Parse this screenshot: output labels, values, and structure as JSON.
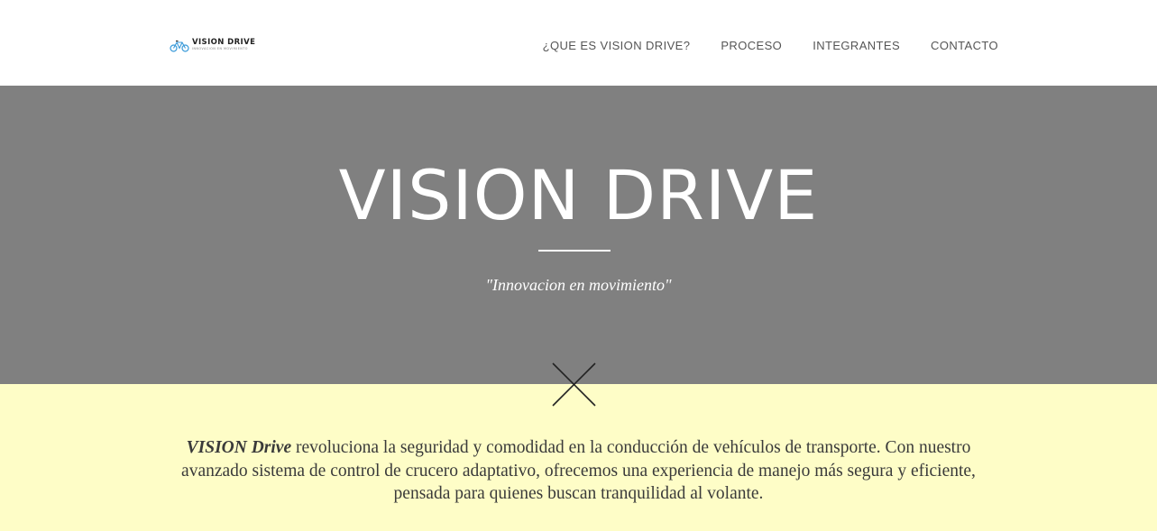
{
  "header": {
    "logo": {
      "name": "VISION DRIVE",
      "tagline": "INNOVACION EN MOVIMIENTO",
      "icon": "bicycle-car-icon"
    },
    "nav": [
      {
        "label": "¿QUE ES VISION DRIVE?"
      },
      {
        "label": "PROCESO"
      },
      {
        "label": "INTEGRANTES"
      },
      {
        "label": "CONTACTO"
      }
    ]
  },
  "hero": {
    "title": "VISION DRIVE",
    "subtitle": "\"Innovacion en movimiento\"",
    "background_color": "#808080"
  },
  "close_icon": "close-icon",
  "about": {
    "brand": "VISION Drive",
    "text": " revoluciona la seguridad y comodidad en la conducción de vehículos de transporte. Con nuestro avanzado sistema de control de crucero adaptativo, ofrecemos una experiencia de manejo más segura y eficiente, pensada para quienes buscan tranquilidad al volante.",
    "background_color": "#fefdc7"
  }
}
